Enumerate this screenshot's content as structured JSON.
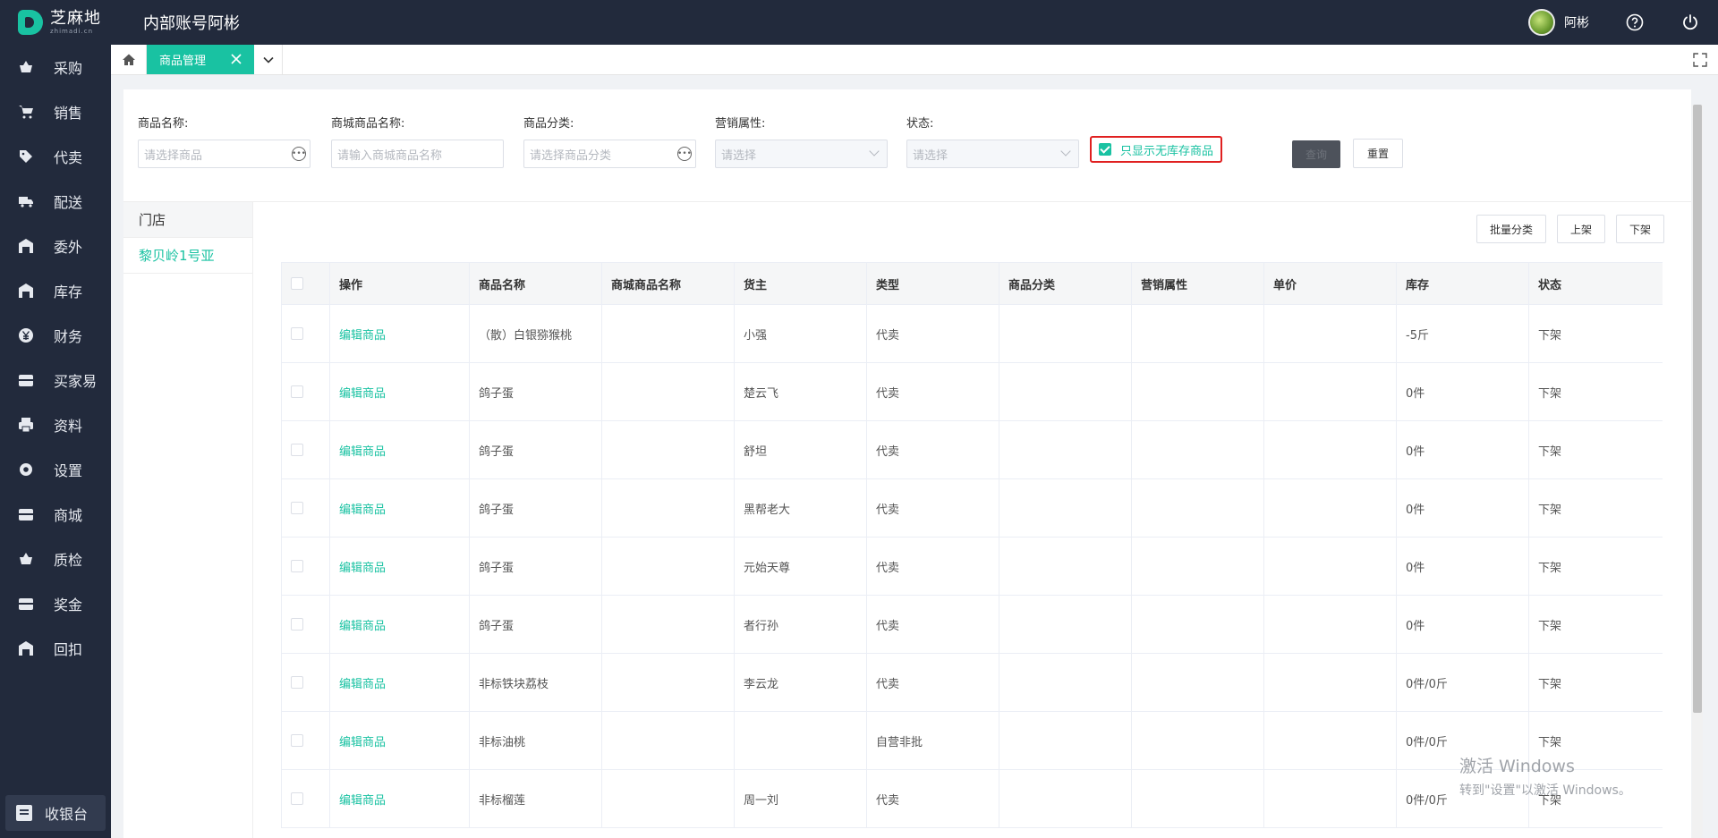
{
  "topbar": {
    "logo_cn": "芝麻地",
    "logo_en": "zhimadi.cn",
    "account": "内部账号阿彬",
    "username": "阿彬"
  },
  "sidebar": {
    "items": [
      {
        "label": "采购",
        "icon": "basket-icon"
      },
      {
        "label": "销售",
        "icon": "cart-icon"
      },
      {
        "label": "代卖",
        "icon": "tag-icon"
      },
      {
        "label": "配送",
        "icon": "truck-icon"
      },
      {
        "label": "委外",
        "icon": "warehouse-icon"
      },
      {
        "label": "库存",
        "icon": "warehouse-icon"
      },
      {
        "label": "财务",
        "icon": "yen-icon"
      },
      {
        "label": "买家易",
        "icon": "storefront-icon"
      },
      {
        "label": "资料",
        "icon": "printer-icon"
      },
      {
        "label": "设置",
        "icon": "gear-icon"
      },
      {
        "label": "商城",
        "icon": "storefront-icon"
      },
      {
        "label": "质检",
        "icon": "basket-icon"
      },
      {
        "label": "奖金",
        "icon": "storefront-icon"
      },
      {
        "label": "回扣",
        "icon": "warehouse-icon"
      }
    ],
    "cashier": "收银台"
  },
  "tabs": {
    "active": "商品管理"
  },
  "filters": {
    "product_name": {
      "label": "商品名称:",
      "placeholder": "请选择商品"
    },
    "mall_name": {
      "label": "商城商品名称:",
      "placeholder": "请输入商城商品名称"
    },
    "category": {
      "label": "商品分类:",
      "placeholder": "请选择商品分类"
    },
    "marketing": {
      "label": "营销属性:",
      "placeholder": "请选择"
    },
    "status": {
      "label": "状态:",
      "placeholder": "请选择"
    },
    "only_no_stock": "只显示无库存商品",
    "query_button": "查询",
    "reset_button": "重置"
  },
  "stores": {
    "header": "门店",
    "items": [
      "黎贝岭1号亚"
    ]
  },
  "actions": {
    "batch_category": "批量分类",
    "on_shelf": "上架",
    "off_shelf": "下架"
  },
  "table": {
    "columns": [
      "操作",
      "商品名称",
      "商城商品名称",
      "货主",
      "类型",
      "商品分类",
      "营销属性",
      "单价",
      "库存",
      "状态"
    ],
    "rows": [
      {
        "op": "编辑商品",
        "name": "（散）白银猕猴桃",
        "mall": "",
        "owner": "小强",
        "type": "代卖",
        "cat": "",
        "mkt": "",
        "price": "",
        "stock": "-5斤",
        "status": "下架"
      },
      {
        "op": "编辑商品",
        "name": "鸽子蛋",
        "mall": "",
        "owner": "楚云飞",
        "type": "代卖",
        "cat": "",
        "mkt": "",
        "price": "",
        "stock": "0件",
        "status": "下架"
      },
      {
        "op": "编辑商品",
        "name": "鸽子蛋",
        "mall": "",
        "owner": "舒坦",
        "type": "代卖",
        "cat": "",
        "mkt": "",
        "price": "",
        "stock": "0件",
        "status": "下架"
      },
      {
        "op": "编辑商品",
        "name": "鸽子蛋",
        "mall": "",
        "owner": "黑帮老大",
        "type": "代卖",
        "cat": "",
        "mkt": "",
        "price": "",
        "stock": "0件",
        "status": "下架"
      },
      {
        "op": "编辑商品",
        "name": "鸽子蛋",
        "mall": "",
        "owner": "元始天尊",
        "type": "代卖",
        "cat": "",
        "mkt": "",
        "price": "",
        "stock": "0件",
        "status": "下架"
      },
      {
        "op": "编辑商品",
        "name": "鸽子蛋",
        "mall": "",
        "owner": "者行孙",
        "type": "代卖",
        "cat": "",
        "mkt": "",
        "price": "",
        "stock": "0件",
        "status": "下架"
      },
      {
        "op": "编辑商品",
        "name": "非标铁块荔枝",
        "mall": "",
        "owner": "李云龙",
        "type": "代卖",
        "cat": "",
        "mkt": "",
        "price": "",
        "stock": "0件/0斤",
        "status": "下架"
      },
      {
        "op": "编辑商品",
        "name": "非标油桃",
        "mall": "",
        "owner": "",
        "type": "自营非批",
        "cat": "",
        "mkt": "",
        "price": "",
        "stock": "0件/0斤",
        "status": "下架"
      },
      {
        "op": "编辑商品",
        "name": "非标榴莲",
        "mall": "",
        "owner": "周一刘",
        "type": "代卖",
        "cat": "",
        "mkt": "",
        "price": "",
        "stock": "0件/0斤",
        "status": "下架"
      }
    ]
  },
  "watermark": {
    "line1": "激活 Windows",
    "line2": "转到\"设置\"以激活 Windows。"
  },
  "colors": {
    "accent": "#19c2a2",
    "sidebar_bg": "#222a3c",
    "highlight_border": "#e02020"
  }
}
